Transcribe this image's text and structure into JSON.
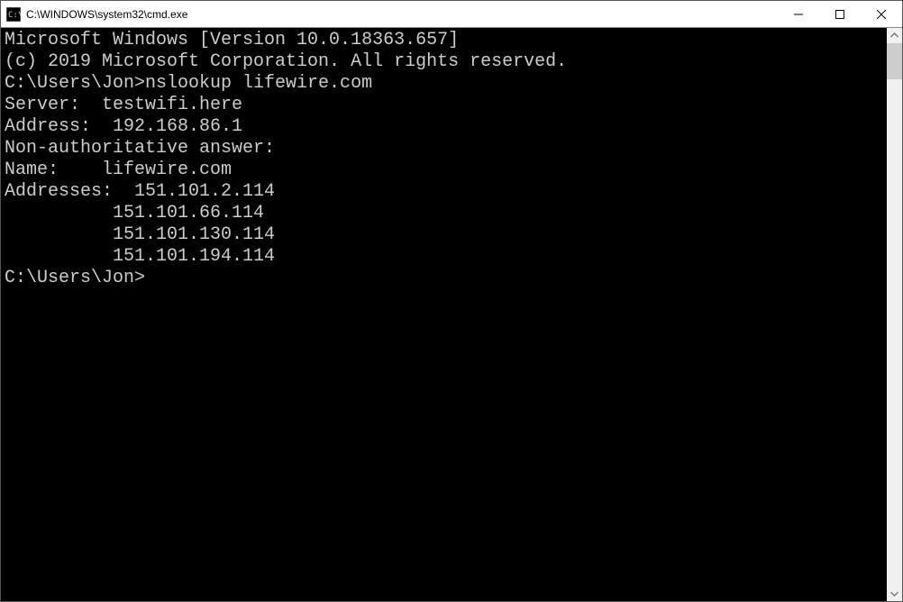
{
  "window": {
    "title": "C:\\WINDOWS\\system32\\cmd.exe"
  },
  "terminal": {
    "lines": [
      "Microsoft Windows [Version 10.0.18363.657]",
      "(c) 2019 Microsoft Corporation. All rights reserved.",
      "",
      "C:\\Users\\Jon>nslookup lifewire.com",
      "Server:  testwifi.here",
      "Address:  192.168.86.1",
      "",
      "Non-authoritative answer:",
      "Name:    lifewire.com",
      "Addresses:  151.101.2.114",
      "          151.101.66.114",
      "          151.101.130.114",
      "          151.101.194.114",
      "",
      "",
      "C:\\Users\\Jon>"
    ]
  }
}
